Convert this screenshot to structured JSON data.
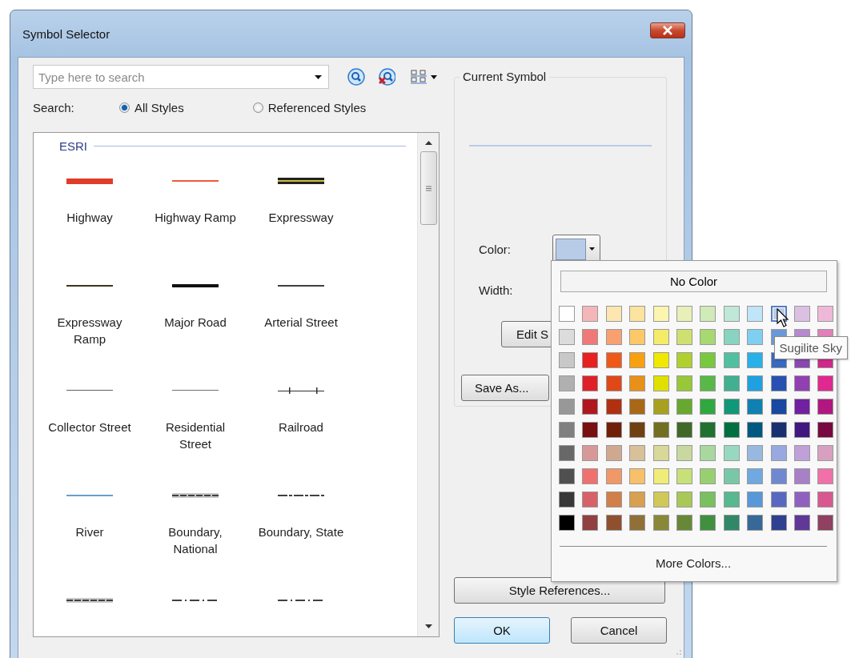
{
  "window": {
    "title": "Symbol Selector"
  },
  "search": {
    "placeholder": "Type here to search",
    "label": "Search:"
  },
  "radios": [
    {
      "label": "All Styles",
      "selected": true
    },
    {
      "label": "Referenced Styles",
      "selected": false
    }
  ],
  "symbol_list": {
    "group": "ESRI",
    "symbols": [
      {
        "name": "Highway",
        "kind": "thick",
        "color": "#e03c28"
      },
      {
        "name": "Highway Ramp",
        "kind": "thin",
        "color": "#f05a3c"
      },
      {
        "name": "Expressway",
        "kind": "cased",
        "color": "#c8c040"
      },
      {
        "name": "Expressway Ramp",
        "kind": "thin",
        "color": "#3a3618"
      },
      {
        "name": "Major Road",
        "kind": "medium",
        "color": "#101010"
      },
      {
        "name": "Arterial Street",
        "kind": "thin",
        "color": "#404040"
      },
      {
        "name": "Collector Street",
        "kind": "hairline",
        "color": "#606060"
      },
      {
        "name": "Residential Street",
        "kind": "hairline",
        "color": "#707070"
      },
      {
        "name": "Railroad",
        "kind": "railroad",
        "color": "#303030"
      },
      {
        "name": "River",
        "kind": "thin",
        "color": "#6aa0c8"
      },
      {
        "name": "Boundary, National",
        "kind": "dashed-cased",
        "color": "#404040"
      },
      {
        "name": "Boundary, State",
        "kind": "dashed",
        "color": "#404040"
      },
      {
        "kind": "dashed-cased",
        "color": "#404040"
      },
      {
        "kind": "dash-dot",
        "color": "#404040"
      },
      {
        "kind": "dash-dot",
        "color": "#404040"
      }
    ]
  },
  "current_symbol": {
    "title": "Current Symbol",
    "color_label": "Color:",
    "width_label": "Width:",
    "color_button": {
      "color": "#b8cce8"
    },
    "edit_button": "Edit S",
    "save_button": "Save As..."
  },
  "style_references_button": "Style References...",
  "ok_button": "OK",
  "cancel_button": "Cancel",
  "palette": {
    "no_color": "No Color",
    "more_colors": "More Colors...",
    "tooltip": "Sugilite Sky",
    "rows": [
      {
        "swatches": [
          {
            "color": "#ffffff",
            "selected": false
          },
          {
            "color": "#f4b6b8",
            "selected": false
          },
          {
            "color": "#fde6b0",
            "selected": false
          },
          {
            "color": "#fce3a0",
            "selected": false
          },
          {
            "color": "#fbf5b0",
            "selected": false
          },
          {
            "color": "#e8f0b8",
            "selected": false
          },
          {
            "color": "#d0eab8",
            "selected": false
          },
          {
            "color": "#c0e8d8",
            "selected": false
          },
          {
            "color": "#c0e4f8",
            "selected": false
          },
          {
            "color": "#b8cce8",
            "selected": true
          },
          {
            "color": "#dcc0e4",
            "selected": false
          },
          {
            "color": "#f0b8d8",
            "selected": false
          }
        ]
      },
      {
        "swatches": [
          {
            "color": "#dcdcdc",
            "selected": false
          },
          {
            "color": "#f07878",
            "selected": false
          },
          {
            "color": "#f8a070",
            "selected": false
          },
          {
            "color": "#fcc868",
            "selected": false
          },
          {
            "color": "#f4ec68",
            "selected": false
          },
          {
            "color": "#d0e070",
            "selected": false
          },
          {
            "color": "#a8d870",
            "selected": false
          },
          {
            "color": "#88d4c0",
            "selected": false
          },
          {
            "color": "#80cff0",
            "selected": false
          },
          {
            "color": "#6898d8",
            "selected": false
          },
          {
            "color": "#b888d0",
            "selected": false
          },
          {
            "color": "#e080b8",
            "selected": false
          }
        ]
      },
      {
        "swatches": [
          {
            "color": "#c8c8c8",
            "selected": false
          },
          {
            "color": "#e82020",
            "selected": false
          },
          {
            "color": "#f05818",
            "selected": false
          },
          {
            "color": "#f8a010",
            "selected": false
          },
          {
            "color": "#f0e800",
            "selected": false
          },
          {
            "color": "#b0d030",
            "selected": false
          },
          {
            "color": "#78c840",
            "selected": false
          },
          {
            "color": "#50c0a0",
            "selected": false
          },
          {
            "color": "#28b0e8",
            "selected": false
          },
          {
            "color": "#3868c0",
            "selected": false
          },
          {
            "color": "#8848b0",
            "selected": false
          },
          {
            "color": "#d02888",
            "selected": false
          }
        ]
      },
      {
        "swatches": [
          {
            "color": "#b0b0b0",
            "selected": false
          },
          {
            "color": "#e02028",
            "selected": false
          },
          {
            "color": "#e04818",
            "selected": false
          },
          {
            "color": "#e89018",
            "selected": false
          },
          {
            "color": "#e0e000",
            "selected": false
          },
          {
            "color": "#98c838",
            "selected": false
          },
          {
            "color": "#58b848",
            "selected": false
          },
          {
            "color": "#40b090",
            "selected": false
          },
          {
            "color": "#20a0e0",
            "selected": false
          },
          {
            "color": "#2850b0",
            "selected": false
          },
          {
            "color": "#9040b0",
            "selected": false
          },
          {
            "color": "#e02890",
            "selected": false
          }
        ]
      },
      {
        "swatches": [
          {
            "color": "#989898",
            "selected": false
          },
          {
            "color": "#b01820",
            "selected": false
          },
          {
            "color": "#b03010",
            "selected": false
          },
          {
            "color": "#a86818",
            "selected": false
          },
          {
            "color": "#a8a020",
            "selected": false
          },
          {
            "color": "#68a830",
            "selected": false
          },
          {
            "color": "#30a840",
            "selected": false
          },
          {
            "color": "#109878",
            "selected": false
          },
          {
            "color": "#1080b0",
            "selected": false
          },
          {
            "color": "#1848a0",
            "selected": false
          },
          {
            "color": "#7020a0",
            "selected": false
          },
          {
            "color": "#b01880",
            "selected": false
          }
        ]
      },
      {
        "swatches": [
          {
            "color": "#808080",
            "selected": false
          },
          {
            "color": "#781010",
            "selected": false
          },
          {
            "color": "#702008",
            "selected": false
          },
          {
            "color": "#704010",
            "selected": false
          },
          {
            "color": "#707020",
            "selected": false
          },
          {
            "color": "#406828",
            "selected": false
          },
          {
            "color": "#207030",
            "selected": false
          },
          {
            "color": "#007040",
            "selected": false
          },
          {
            "color": "#005880",
            "selected": false
          },
          {
            "color": "#183070",
            "selected": false
          },
          {
            "color": "#401880",
            "selected": false
          },
          {
            "color": "#780840",
            "selected": false
          }
        ]
      },
      {
        "swatches": [
          {
            "color": "#686868",
            "selected": false
          },
          {
            "color": "#d89898",
            "selected": false
          },
          {
            "color": "#d0a890",
            "selected": false
          },
          {
            "color": "#d8c098",
            "selected": false
          },
          {
            "color": "#d8d898",
            "selected": false
          },
          {
            "color": "#c8d8a0",
            "selected": false
          },
          {
            "color": "#a8d8a0",
            "selected": false
          },
          {
            "color": "#98d8c0",
            "selected": false
          },
          {
            "color": "#98b8e0",
            "selected": false
          },
          {
            "color": "#98a8e0",
            "selected": false
          },
          {
            "color": "#c0a0d8",
            "selected": false
          },
          {
            "color": "#d8a0c0",
            "selected": false
          }
        ]
      },
      {
        "swatches": [
          {
            "color": "#505050",
            "selected": false
          },
          {
            "color": "#f07070",
            "selected": false
          },
          {
            "color": "#f09868",
            "selected": false
          },
          {
            "color": "#f8c068",
            "selected": false
          },
          {
            "color": "#f0ec78",
            "selected": false
          },
          {
            "color": "#c8e078",
            "selected": false
          },
          {
            "color": "#98d070",
            "selected": false
          },
          {
            "color": "#78c8a8",
            "selected": false
          },
          {
            "color": "#70a8e0",
            "selected": false
          },
          {
            "color": "#7088d0",
            "selected": false
          },
          {
            "color": "#a880c8",
            "selected": false
          },
          {
            "color": "#f070a8",
            "selected": false
          }
        ]
      },
      {
        "swatches": [
          {
            "color": "#383838",
            "selected": false
          },
          {
            "color": "#d86068",
            "selected": false
          },
          {
            "color": "#d08048",
            "selected": false
          },
          {
            "color": "#d8a050",
            "selected": false
          },
          {
            "color": "#d0c858",
            "selected": false
          },
          {
            "color": "#a8c858",
            "selected": false
          },
          {
            "color": "#78c060",
            "selected": false
          },
          {
            "color": "#58b890",
            "selected": false
          },
          {
            "color": "#5898d8",
            "selected": false
          },
          {
            "color": "#5868c0",
            "selected": false
          },
          {
            "color": "#9060c0",
            "selected": false
          },
          {
            "color": "#d85890",
            "selected": false
          }
        ]
      },
      {
        "swatches": [
          {
            "color": "#000000",
            "selected": false
          },
          {
            "color": "#904040",
            "selected": false
          },
          {
            "color": "#905030",
            "selected": false
          },
          {
            "color": "#907038",
            "selected": false
          },
          {
            "color": "#888838",
            "selected": false
          },
          {
            "color": "#688838",
            "selected": false
          },
          {
            "color": "#409040",
            "selected": false
          },
          {
            "color": "#308868",
            "selected": false
          },
          {
            "color": "#386898",
            "selected": false
          },
          {
            "color": "#304090",
            "selected": false
          },
          {
            "color": "#603898",
            "selected": false
          },
          {
            "color": "#904060",
            "selected": false
          }
        ]
      }
    ]
  }
}
